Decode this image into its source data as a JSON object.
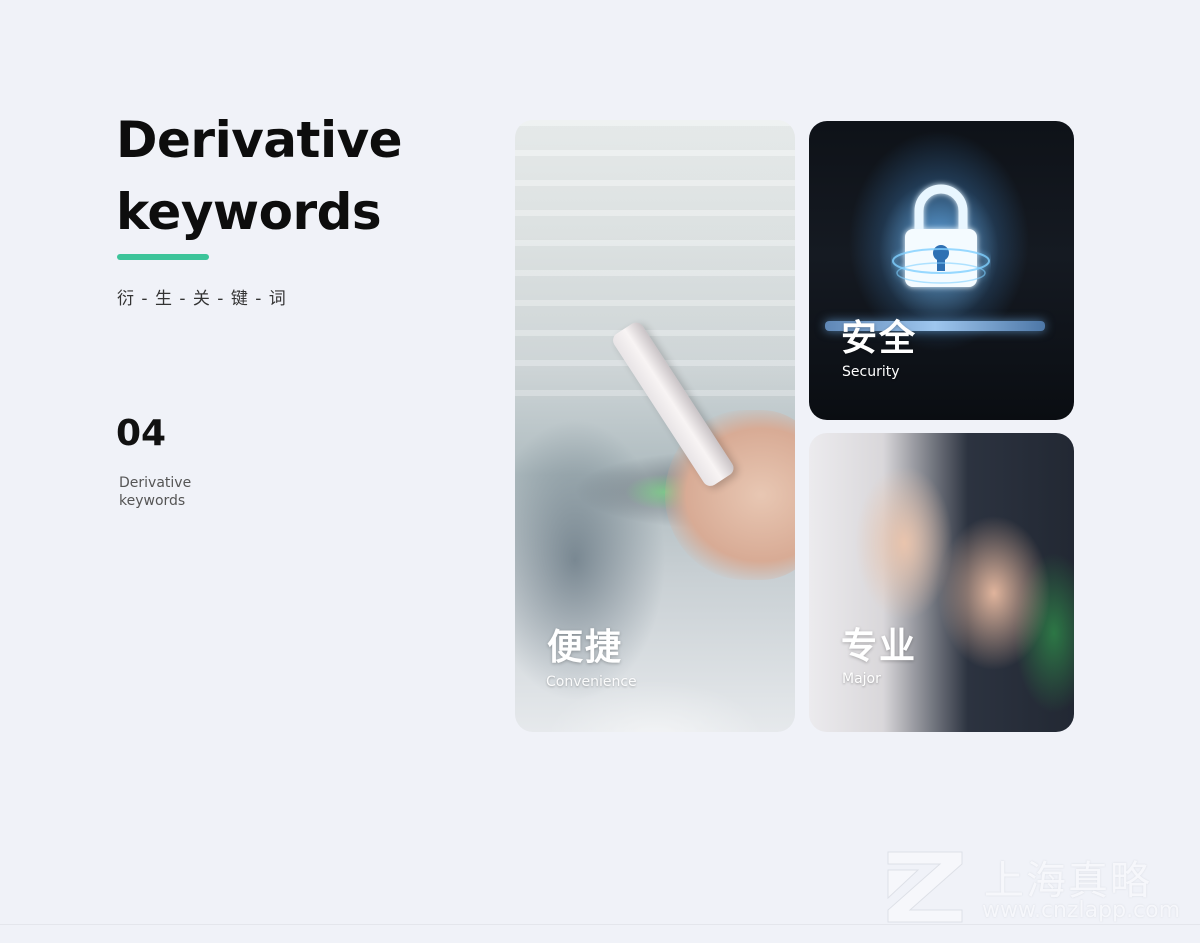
{
  "title": {
    "line1": "Derivative",
    "line2": "keywords"
  },
  "subtitle_cn": "衍 - 生 - 关 - 键 - 词",
  "section": {
    "number": "04",
    "label": "Derivative keywords"
  },
  "cards": [
    {
      "cn": "便捷",
      "en": "Convenience"
    },
    {
      "cn": "安全",
      "en": "Security"
    },
    {
      "cn": "专业",
      "en": "Major"
    }
  ],
  "watermark": {
    "cn": "上海真略",
    "url": "www.cnzlapp.com"
  },
  "colors": {
    "accent": "#3cc49a",
    "background": "#f0f2f8"
  }
}
